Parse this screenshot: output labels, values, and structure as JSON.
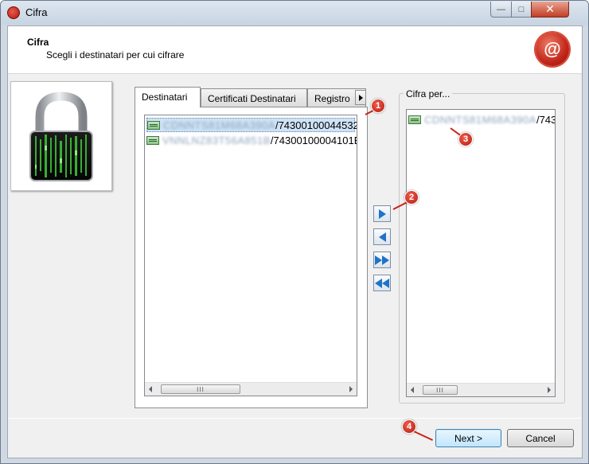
{
  "window": {
    "title": "Cifra",
    "controls": {
      "minimize": "—",
      "maximize": "□",
      "close": "✕"
    }
  },
  "header": {
    "title": "Cifra",
    "subtitle": "Scegli i destinatari per cui cifrare",
    "logo_icon": "wax-seal-at-icon",
    "logo_text": "@"
  },
  "tabs": [
    {
      "label": "Destinatari",
      "active": true
    },
    {
      "label": "Certificati Destinatari",
      "active": false
    },
    {
      "label": "Registro",
      "active": false
    }
  ],
  "recipients_list": {
    "items": [
      {
        "name_blurred": "CDNNTS81M68A390A",
        "suffix": "/74300100044532",
        "selected": true
      },
      {
        "name_blurred": "VNNLNZ83T56A851B",
        "suffix": "/74300100004101B",
        "selected": false
      }
    ],
    "scroll_thumb": "III"
  },
  "move_buttons": [
    {
      "name": "add-button",
      "icon": "arrow-right-icon"
    },
    {
      "name": "remove-button",
      "icon": "arrow-left-icon"
    },
    {
      "name": "add-all-button",
      "icon": "double-arrow-right-icon"
    },
    {
      "name": "remove-all-button",
      "icon": "double-arrow-left-icon"
    }
  ],
  "encrypt_for": {
    "label": "Cifra per...",
    "items": [
      {
        "name_blurred": "CDNNTS81M68A390A",
        "suffix": "/743"
      }
    ],
    "scroll_thumb": "III"
  },
  "buttons": {
    "next": "Next >",
    "cancel": "Cancel"
  },
  "callouts": [
    "1",
    "2",
    "3",
    "4"
  ],
  "colors": {
    "accent_blue": "#1e73c8",
    "callout_red": "#c82318",
    "selection": "#cfe3f5"
  }
}
